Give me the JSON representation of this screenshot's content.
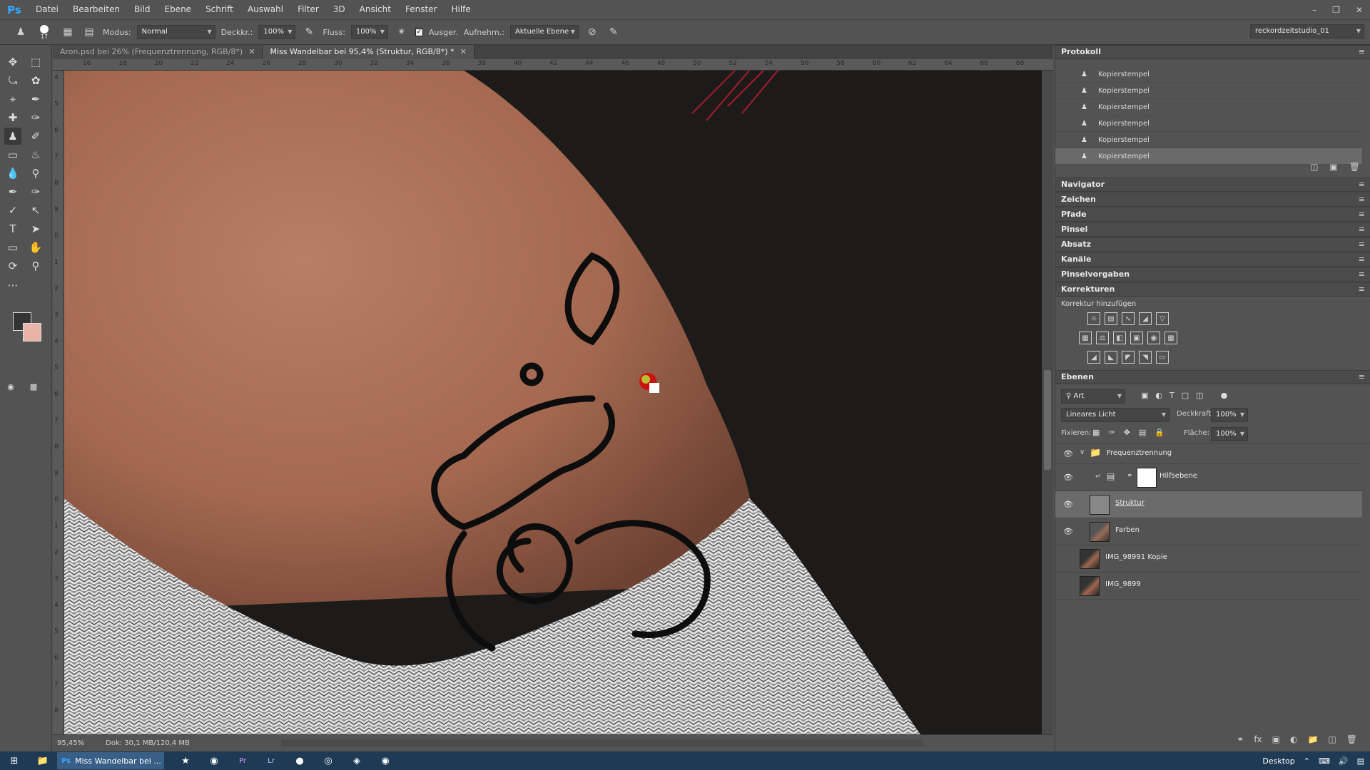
{
  "app": {
    "logo": "Ps"
  },
  "menu": [
    "Datei",
    "Bearbeiten",
    "Bild",
    "Ebene",
    "Schrift",
    "Auswahl",
    "Filter",
    "3D",
    "Ansicht",
    "Fenster",
    "Hilfe"
  ],
  "options": {
    "brush_size": "17",
    "modus_label": "Modus:",
    "modus_value": "Normal",
    "deckkr_label": "Deckkr.:",
    "deckkr_value": "100%",
    "fluss_label": "Fluss:",
    "fluss_value": "100%",
    "ausger_label": "Ausger.",
    "aufnehm_label": "Aufnehm.:",
    "aufnehm_value": "Aktuelle Ebene",
    "workspace": "reckordzeitstudio_01"
  },
  "tabs": [
    {
      "label": "Aron.psd bei 26% (Frequenztrennung, RGB/8*)",
      "active": false
    },
    {
      "label": "Miss Wandelbar bei 95,4% (Struktur, RGB/8*) *",
      "active": true
    }
  ],
  "ruler_top": [
    "16",
    "18",
    "20",
    "22",
    "24",
    "26",
    "28",
    "30",
    "32",
    "34",
    "36",
    "38",
    "40",
    "42",
    "44",
    "46",
    "48",
    "50",
    "52",
    "54",
    "56",
    "58",
    "60",
    "62",
    "64",
    "66",
    "68"
  ],
  "ruler_left": [
    "4",
    "5",
    "6",
    "7",
    "8",
    "9",
    "0",
    "1",
    "2",
    "3",
    "4",
    "5",
    "6",
    "7",
    "8",
    "9",
    "0",
    "1",
    "2",
    "3",
    "4",
    "5",
    "6",
    "7",
    "8"
  ],
  "status": {
    "zoom": "95,45%",
    "doc": "Dok: 30,1 MB/120,4 MB"
  },
  "history": {
    "title": "Protokoll",
    "items": [
      {
        "label": "Kopierstempel",
        "selected": false
      },
      {
        "label": "Kopierstempel",
        "selected": false
      },
      {
        "label": "Kopierstempel",
        "selected": false
      },
      {
        "label": "Kopierstempel",
        "selected": false
      },
      {
        "label": "Kopierstempel",
        "selected": false
      },
      {
        "label": "Kopierstempel",
        "selected": true
      }
    ]
  },
  "collapsed_panels": [
    "Navigator",
    "Zeichen",
    "Pfade",
    "Pinsel",
    "Absatz",
    "Kanäle",
    "Pinselvorgaben"
  ],
  "adjustments": {
    "title": "Korrekturen",
    "subtitle": "Korrektur hinzufügen"
  },
  "layers": {
    "title": "Ebenen",
    "filter": "Art",
    "blend_mode": "Lineares Licht",
    "opacity_label": "Deckkraft:",
    "opacity_value": "100%",
    "lock_label": "Fixieren:",
    "fill_label": "Fläche:",
    "fill_value": "100%",
    "items": [
      {
        "name": "Frequenztrennung",
        "type": "group",
        "visible": true,
        "selected": false
      },
      {
        "name": "Hilfsebene",
        "type": "adjustment",
        "visible": true,
        "selected": false
      },
      {
        "name": "Struktur",
        "type": "layer",
        "visible": true,
        "selected": true
      },
      {
        "name": "Farben",
        "type": "layer",
        "visible": true,
        "selected": false
      },
      {
        "name": "IMG_98991 Kopie",
        "type": "layer",
        "visible": false,
        "selected": false
      },
      {
        "name": "IMG_9899",
        "type": "layer",
        "visible": false,
        "selected": false
      }
    ]
  },
  "taskbar": {
    "active_app": "Miss Wandelbar bei ...",
    "desktop": "Desktop"
  }
}
